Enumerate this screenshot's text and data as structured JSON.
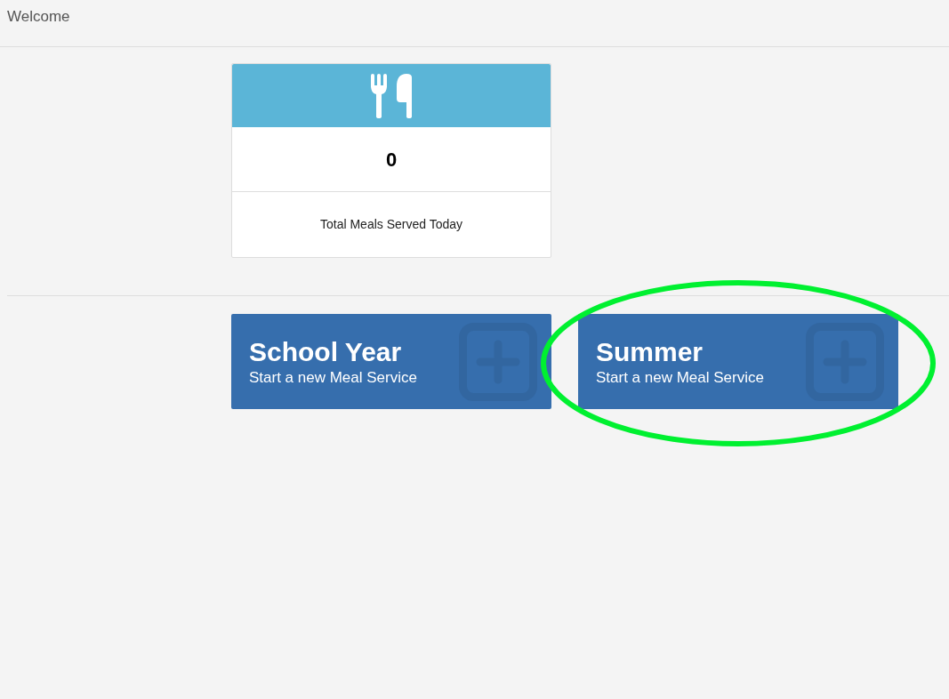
{
  "header": {
    "title": "Welcome"
  },
  "stat_card": {
    "value": "0",
    "label": "Total Meals Served Today"
  },
  "service_buttons": [
    {
      "title": "School Year",
      "subtitle": "Start a new Meal Service",
      "highlighted": false
    },
    {
      "title": "Summer",
      "subtitle": "Start a new Meal Service",
      "highlighted": true
    }
  ]
}
